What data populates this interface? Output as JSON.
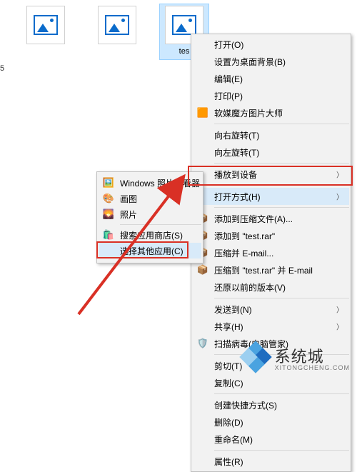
{
  "files": [
    {
      "name": ""
    },
    {
      "name": ""
    },
    {
      "name": "tes",
      "selected": true
    }
  ],
  "truncated_label": "5",
  "context_menu": {
    "open": "打开(O)",
    "set_bg": "设置为桌面背景(B)",
    "edit": "编辑(E)",
    "print": "打印(P)",
    "ruanmei": "软媒魔方图片大师",
    "rotate_r": "向右旋转(T)",
    "rotate_l": "向左旋转(T)",
    "cast": "播放到设备",
    "open_with": "打开方式(H)",
    "add_archive": "添加到压缩文件(A)...",
    "add_testrar": "添加到 \"test.rar\"",
    "email_archive": "压缩并 E-mail...",
    "email_testrar": "压缩到 \"test.rar\" 并 E-mail",
    "restore_prev": "还原以前的版本(V)",
    "send_to": "发送到(N)",
    "sharing": "共享(H)",
    "scan": "扫描病毒(电脑管家)",
    "cut": "剪切(T)",
    "copy": "复制(C)",
    "shortcut": "创建快捷方式(S)",
    "delete": "删除(D)",
    "rename": "重命名(M)",
    "props": "属性(R)"
  },
  "submenu": {
    "photo_viewer": "Windows 照片查看器",
    "paint": "画图",
    "photos": "照片",
    "store": "搜索应用商店(S)",
    "choose": "选择其他应用(C)"
  },
  "watermark": {
    "title": "系统城",
    "sub": "XITONGCHENG.COM"
  }
}
